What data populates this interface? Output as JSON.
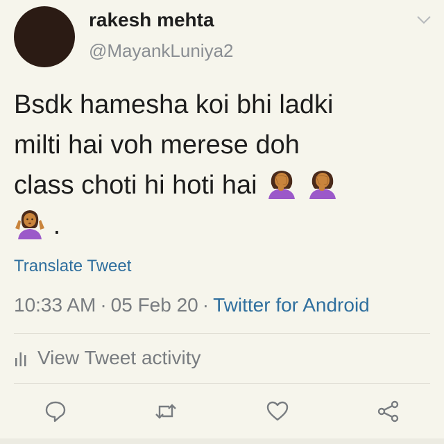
{
  "tweet": {
    "author_name": "rakesh mehta",
    "author_handle": "@MayankLuniya2",
    "text_line1": "Bsdk hamesha koi bhi ladki",
    "text_line2": "milti hai voh merese doh",
    "text_line3": "class choti hi hoti hai",
    "text_end": ".",
    "emojis": [
      "woman-facepalming-icon",
      "woman-facepalming-icon",
      "woman-shrugging-icon"
    ],
    "translate_label": "Translate Tweet",
    "time": "10:33 AM",
    "date": "05 Feb 20",
    "separator": "·",
    "source": "Twitter for Android",
    "activity_label": "View Tweet activity"
  },
  "actions": [
    "reply-icon",
    "retweet-icon",
    "like-icon",
    "share-icon"
  ],
  "colors": {
    "background": "#f6f5ec",
    "link": "#2f6f9e",
    "muted": "#787c80",
    "emoji_skin": "#c9843c",
    "emoji_shirt": "#9b59c9"
  }
}
